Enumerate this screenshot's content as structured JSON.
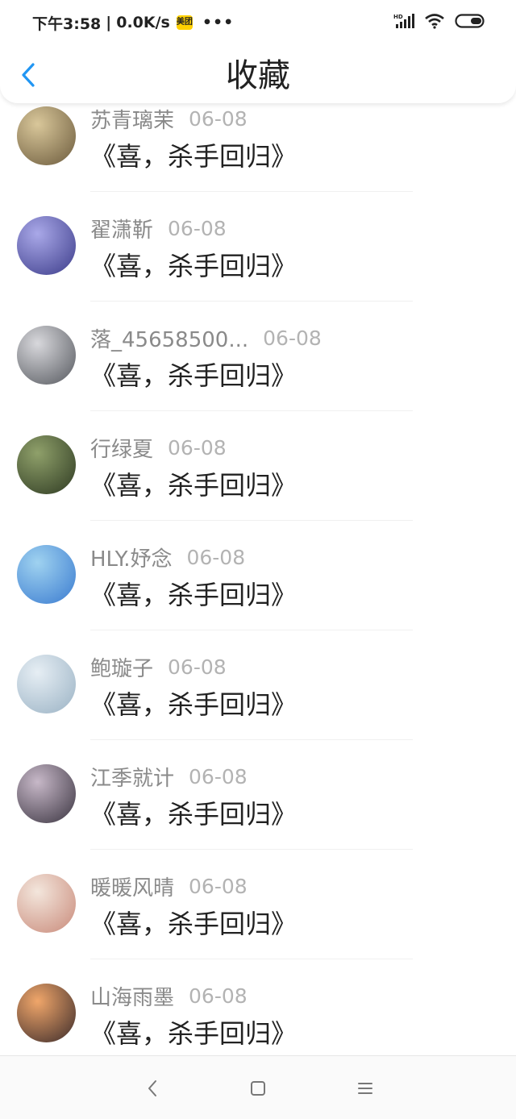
{
  "status_bar": {
    "time": "下午3:58",
    "separator": "|",
    "network_speed": "0.0K/s",
    "app_badge": "美团",
    "more": "•••",
    "icons": [
      "hd-signal-icon",
      "wifi-icon",
      "battery-icon"
    ]
  },
  "header": {
    "title": "收藏",
    "back_icon": "back-arrow-icon",
    "accent_color": "#2196f3"
  },
  "items": [
    {
      "name": "苏青璃茉",
      "date": "06-08",
      "title": "《喜，杀手回归》",
      "avatar_colors": [
        "#d9c79a",
        "#6b5a3c"
      ]
    },
    {
      "name": "翟潇靳",
      "date": "06-08",
      "title": "《喜，杀手回归》",
      "avatar_colors": [
        "#a9a8e8",
        "#3c3c8a"
      ]
    },
    {
      "name": "落_45658500...",
      "date": "06-08",
      "title": "《喜，杀手回归》",
      "avatar_colors": [
        "#d8d8dc",
        "#55585e"
      ]
    },
    {
      "name": "行绿夏",
      "date": "06-08",
      "title": "《喜，杀手回归》",
      "avatar_colors": [
        "#8fa06a",
        "#2e3a22"
      ]
    },
    {
      "name": "HLY.妤念",
      "date": "06-08",
      "title": "《喜，杀手回归》",
      "avatar_colors": [
        "#9fd2f0",
        "#3a7bd0"
      ]
    },
    {
      "name": "鲍璇子",
      "date": "06-08",
      "title": "《喜，杀手回归》",
      "avatar_colors": [
        "#e6eef4",
        "#9ab2c4"
      ]
    },
    {
      "name": "江季就计",
      "date": "06-08",
      "title": "《喜，杀手回归》",
      "avatar_colors": [
        "#c7b8c8",
        "#3a3440"
      ]
    },
    {
      "name": "暖暖风晴",
      "date": "06-08",
      "title": "《喜，杀手回归》",
      "avatar_colors": [
        "#f3e6dc",
        "#c98a7a"
      ]
    },
    {
      "name": "山海雨墨",
      "date": "06-08",
      "title": "《喜，杀手回归》",
      "avatar_colors": [
        "#f0a66a",
        "#3a2a2a"
      ]
    }
  ],
  "system_nav": [
    "back-key-icon",
    "home-key-icon",
    "menu-key-icon"
  ]
}
